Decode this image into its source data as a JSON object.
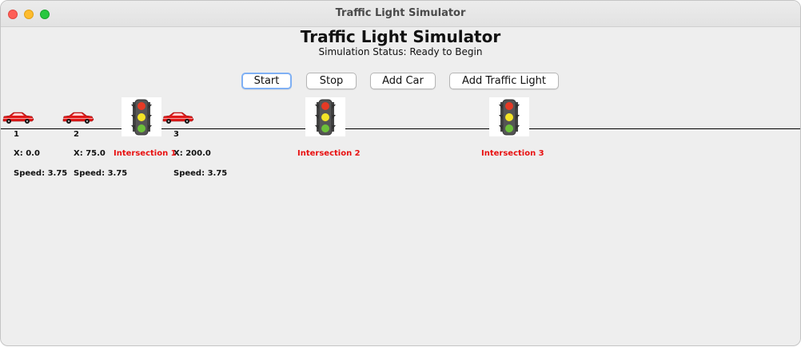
{
  "window": {
    "title": "Traffic Light Simulator"
  },
  "header": {
    "title": "Traffic Light Simulator",
    "status": "Simulation Status: Ready to Begin"
  },
  "toolbar": {
    "start_label": "Start",
    "stop_label": "Stop",
    "add_car_label": "Add Car",
    "add_light_label": "Add Traffic Light"
  },
  "cars": [
    {
      "id": "1",
      "x": "X: 0.0",
      "speed": "Speed: 3.75"
    },
    {
      "id": "2",
      "x": "X: 75.0",
      "speed": "Speed: 3.75"
    },
    {
      "id": "3",
      "x": "X: 200.0",
      "speed": "Speed: 3.75"
    }
  ],
  "intersections": [
    {
      "label": "Intersection 1"
    },
    {
      "label": "Intersection 2"
    },
    {
      "label": "Intersection 3"
    }
  ],
  "colors": {
    "car_body": "#e01818",
    "intersection_label": "#e81010",
    "light_housing": "#555555",
    "light_red": "#e53a25",
    "light_yellow": "#f3e427",
    "light_green": "#6cbf3a",
    "focus_ring": "#7fb0f4"
  }
}
